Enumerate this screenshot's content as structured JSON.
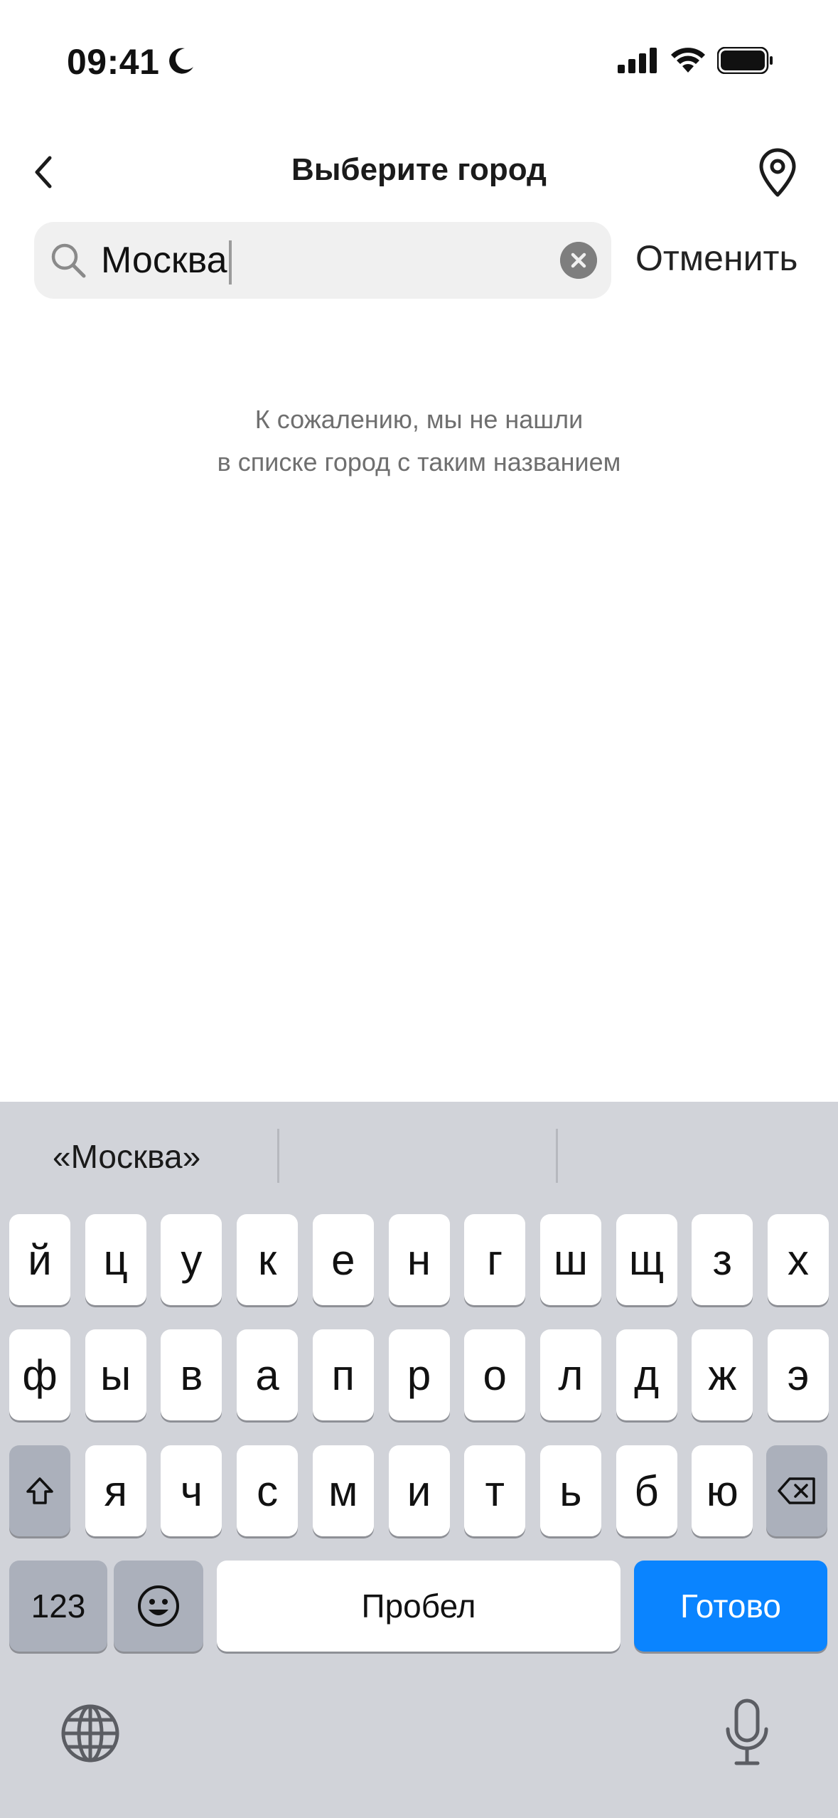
{
  "status_bar": {
    "time": "09:41",
    "icons": [
      "moon-icon",
      "signal-icon",
      "wifi-icon",
      "battery-icon"
    ]
  },
  "header": {
    "title": "Выберите город",
    "back_icon": "chevron-left-icon",
    "location_icon": "location-pin-icon"
  },
  "search": {
    "value": "Москва",
    "cancel_label": "Отменить"
  },
  "empty_state": {
    "line1": "К сожалению, мы не нашли",
    "line2": "в списке город с таким названием"
  },
  "keyboard": {
    "suggestions": [
      "«Москва»",
      "",
      ""
    ],
    "row1": [
      "й",
      "ц",
      "у",
      "к",
      "е",
      "н",
      "г",
      "ш",
      "щ",
      "з",
      "х"
    ],
    "row2": [
      "ф",
      "ы",
      "в",
      "а",
      "п",
      "р",
      "о",
      "л",
      "д",
      "ж",
      "э"
    ],
    "row3": [
      "я",
      "ч",
      "с",
      "м",
      "и",
      "т",
      "ь",
      "б",
      "ю"
    ],
    "numbers_label": "123",
    "space_label": "Пробел",
    "done_label": "Готово"
  },
  "colors": {
    "accent": "#0a84ff",
    "keyboard_bg": "#d1d3d9",
    "search_bg": "#f0f0f0",
    "secondary_text": "#6f6f6f"
  }
}
